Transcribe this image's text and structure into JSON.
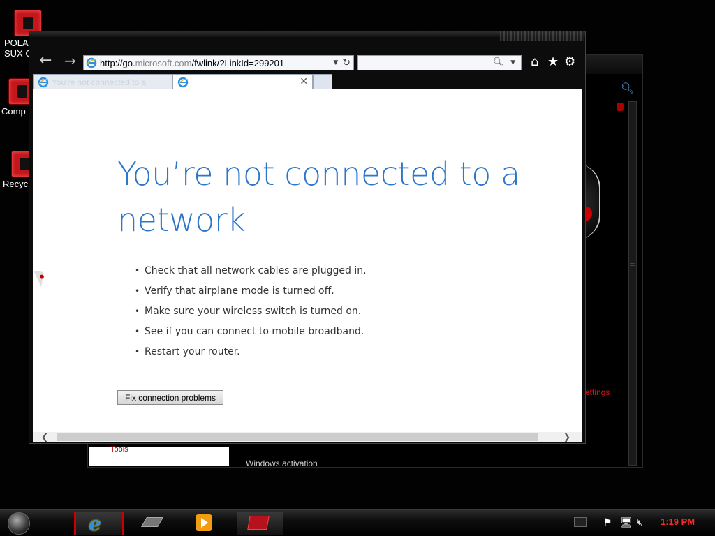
{
  "desktop": {
    "icons": [
      {
        "label": "POLA\nSUX C"
      },
      {
        "label": "Comp"
      },
      {
        "label": "Recyc"
      }
    ]
  },
  "background_window": {
    "link_settings": "ettings",
    "tools_label": "Tools",
    "activation_label": "Windows activation"
  },
  "browser": {
    "address": {
      "prefix": "http://go.",
      "domain": "microsoft.com",
      "suffix": "/fwlink/?LinkId=299201"
    },
    "search_placeholder": "",
    "tabs": [
      {
        "title": "You're not connected to a"
      },
      {
        "title": ""
      }
    ],
    "content": {
      "heading": "You’re not connected to a network",
      "bullets": [
        "Check that all network cables are plugged in.",
        "Verify that airplane mode is turned off.",
        "Make sure your wireless switch is turned on.",
        "See if you can connect to mobile broadband.",
        "Restart your router."
      ],
      "fix_button": "Fix connection problems"
    }
  },
  "taskbar": {
    "clock": "1:19 PM"
  },
  "colors": {
    "heading": "#2e76c9",
    "clock": "#ff2a2a",
    "accent": "#c4161c"
  },
  "icons": {
    "back": "back-arrow-icon",
    "forward": "forward-arrow-icon",
    "home": "home-icon",
    "favorites": "star-icon",
    "tools": "gear-icon",
    "search": "search-icon",
    "refresh": "refresh-icon"
  }
}
